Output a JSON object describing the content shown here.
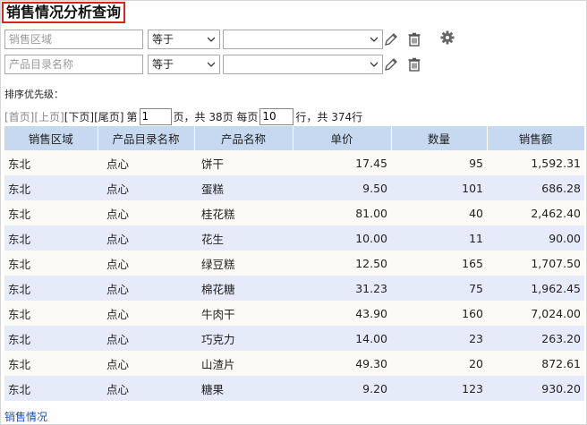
{
  "title": "销售情况分析查询",
  "filters": [
    {
      "placeholder": "销售区域",
      "operator": "等于",
      "value": ""
    },
    {
      "placeholder": "产品目录名称",
      "operator": "等于",
      "value": ""
    }
  ],
  "sort_label": "排序优先级：",
  "pager": {
    "first": "[首页]",
    "prev": "[上页]",
    "next": "[下页]",
    "last": "[尾页]",
    "page_prefix": "第",
    "page_value": "1",
    "page_suffix": "页，共 38页 每页",
    "page_size": "10",
    "rows_suffix": "行，共 374行"
  },
  "table": {
    "headers": [
      "销售区域",
      "产品目录名称",
      "产品名称",
      "单价",
      "数量",
      "销售额"
    ],
    "rows": [
      [
        "东北",
        "点心",
        "饼干",
        "17.45",
        "95",
        "1,592.31"
      ],
      [
        "东北",
        "点心",
        "蛋糕",
        "9.50",
        "101",
        "686.28"
      ],
      [
        "东北",
        "点心",
        "桂花糕",
        "81.00",
        "40",
        "2,462.40"
      ],
      [
        "东北",
        "点心",
        "花生",
        "10.00",
        "11",
        "90.00"
      ],
      [
        "东北",
        "点心",
        "绿豆糕",
        "12.50",
        "165",
        "1,707.50"
      ],
      [
        "东北",
        "点心",
        "棉花糖",
        "31.23",
        "75",
        "1,962.45"
      ],
      [
        "东北",
        "点心",
        "牛肉干",
        "43.90",
        "160",
        "7,024.00"
      ],
      [
        "东北",
        "点心",
        "巧克力",
        "14.00",
        "23",
        "263.20"
      ],
      [
        "东北",
        "点心",
        "山渣片",
        "49.30",
        "20",
        "872.61"
      ],
      [
        "东北",
        "点心",
        "糖果",
        "9.20",
        "123",
        "930.20"
      ]
    ]
  },
  "footer_link": "销售情况",
  "icons": {
    "edit": "pencil-icon",
    "delete": "trash-icon",
    "settings": "gear-icon",
    "dropdown": "chevron-down-icon"
  },
  "colors": {
    "header_bg": "#c6d9f1",
    "row_odd": "#fcfaf6",
    "row_even": "#e6ebf9",
    "title_border": "#d8261b",
    "link": "#1a4fb8"
  }
}
